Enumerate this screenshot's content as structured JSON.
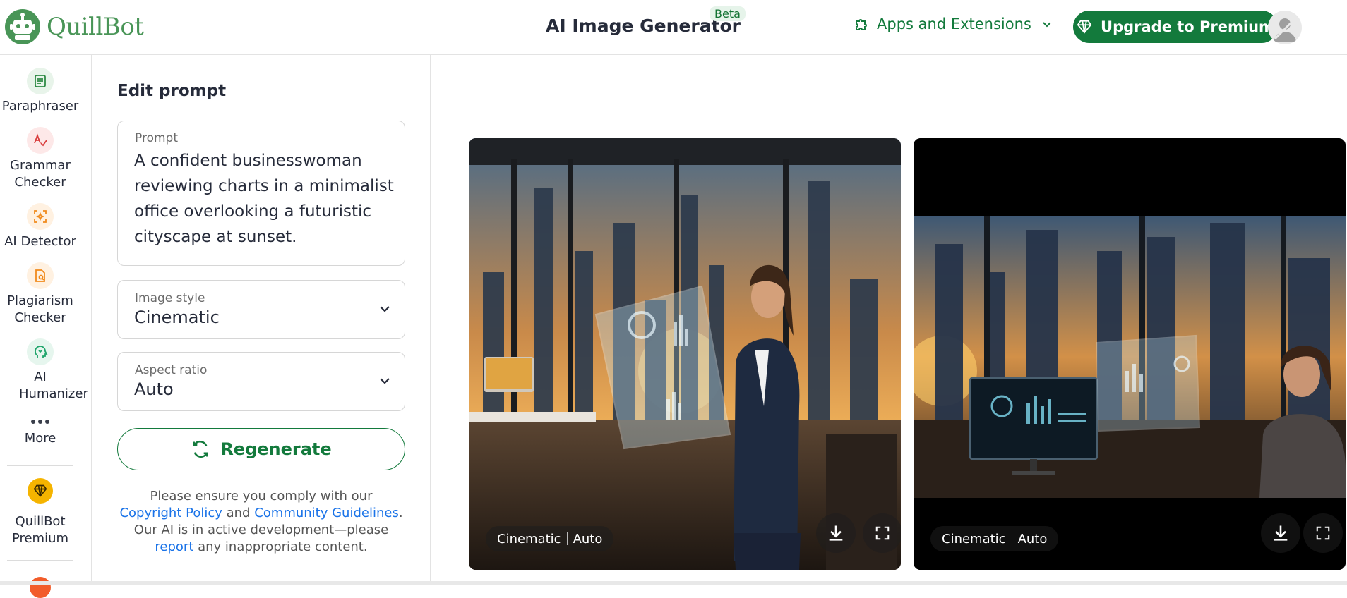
{
  "brand": {
    "name": "QuillBot"
  },
  "header": {
    "title": "AI Image Generator",
    "badge": "Beta",
    "apps_label": "Apps and Extensions",
    "upgrade_label": "Upgrade to Premium"
  },
  "sidebar": {
    "items": [
      {
        "label": "Paraphraser",
        "icon": "paraphraser-icon"
      },
      {
        "label": "Grammar Checker",
        "icon": "grammar-checker-icon"
      },
      {
        "label": "AI Detector",
        "icon": "ai-detector-icon"
      },
      {
        "label": "Plagiarism Checker",
        "icon": "plagiarism-checker-icon"
      },
      {
        "label": "AI Humanizer",
        "icon": "ai-humanizer-icon"
      },
      {
        "label": "More",
        "icon": "more-dots-icon"
      },
      {
        "label": "QuillBot Premium",
        "icon": "premium-diamond-icon"
      }
    ]
  },
  "panel": {
    "title": "Edit prompt",
    "prompt_label": "Prompt",
    "prompt_text": "A confident businesswoman reviewing charts in a minimalist office overlooking a futuristic cityscape at sunset.",
    "style_label": "Image style",
    "style_value": "Cinematic",
    "aspect_label": "Aspect ratio",
    "aspect_value": "Auto",
    "regenerate_label": "Regenerate",
    "notice": {
      "t1": "Please ensure you comply with our ",
      "link1": "Copyright Policy",
      "t2": " and ",
      "link2": "Community Guidelines",
      "t3": ". Our AI is in active development—please ",
      "link3": "report",
      "t4": " any inappropriate content."
    }
  },
  "results": [
    {
      "style": "Cinematic",
      "aspect": "Auto"
    },
    {
      "style": "Cinematic",
      "aspect": "Auto"
    }
  ],
  "colors": {
    "brand_green": "#137a3c",
    "logo_green": "#499557",
    "link_blue": "#1a73e8"
  }
}
